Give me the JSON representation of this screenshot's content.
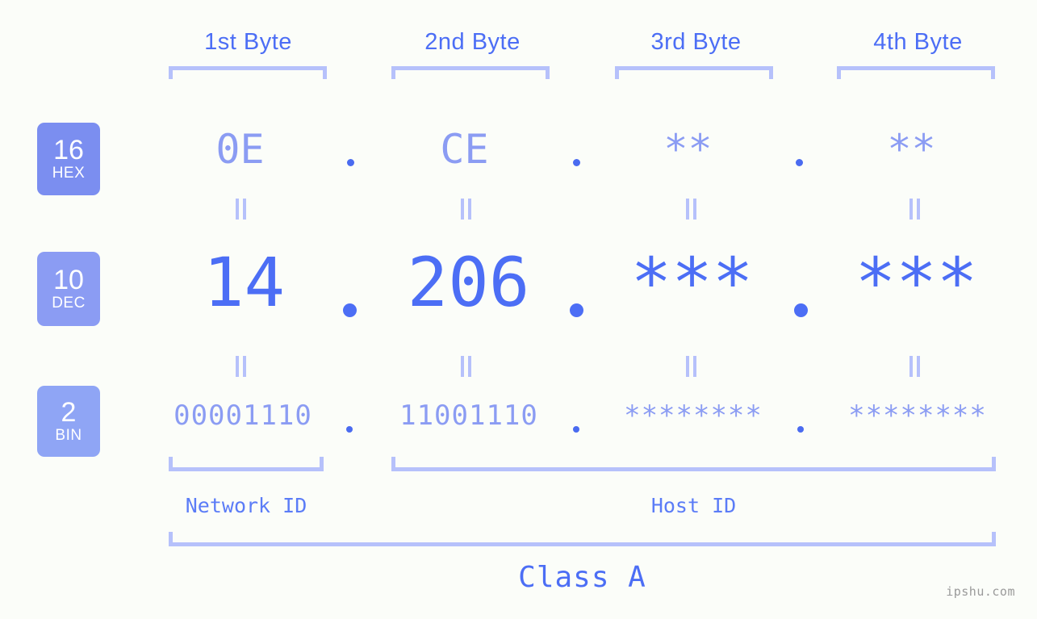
{
  "page": {
    "background": "#fbfdf9",
    "accent": "#4c6ef5",
    "accent_light": "#8b9cf3",
    "bracket_color": "#b6c1fb",
    "watermark": "ipshu.com"
  },
  "headers": [
    {
      "label": "1st Byte"
    },
    {
      "label": "2nd Byte"
    },
    {
      "label": "3rd Byte"
    },
    {
      "label": "4th Byte"
    }
  ],
  "radix_badges": [
    {
      "number": "16",
      "system": "HEX",
      "color": "#7b8ef0"
    },
    {
      "number": "10",
      "system": "DEC",
      "color": "#8b9cf3"
    },
    {
      "number": "2",
      "system": "BIN",
      "color": "#8fa5f5"
    }
  ],
  "rows": {
    "hex": {
      "octets": [
        "0E",
        "CE",
        "**",
        "**"
      ],
      "separator": "."
    },
    "dec": {
      "octets": [
        "14",
        "206",
        "***",
        "***"
      ],
      "separator": "."
    },
    "bin": {
      "octets": [
        "00001110",
        "11001110",
        "********",
        "********"
      ],
      "separator": "."
    }
  },
  "equals_symbol": "||",
  "sections": [
    {
      "label": "Network ID"
    },
    {
      "label": "Host ID"
    }
  ],
  "class": {
    "label": "Class A"
  }
}
